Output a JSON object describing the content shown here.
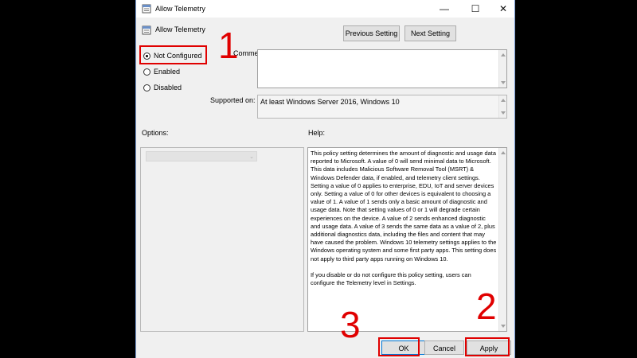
{
  "window": {
    "title": "Allow Telemetry",
    "minimize_glyph": "—",
    "maximize_glyph": "☐",
    "close_glyph": "✕"
  },
  "header": {
    "policy_title": "Allow Telemetry",
    "previous_setting": "Previous Setting",
    "next_setting": "Next Setting"
  },
  "state": {
    "options": [
      {
        "label": "Not Configured",
        "selected": true
      },
      {
        "label": "Enabled",
        "selected": false
      },
      {
        "label": "Disabled",
        "selected": false
      }
    ]
  },
  "comment": {
    "label": "Comment:",
    "value": ""
  },
  "supported": {
    "label": "Supported on:",
    "value": "At least Windows Server 2016, Windows 10"
  },
  "panels": {
    "options_label": "Options:",
    "help_label": "Help:"
  },
  "help": {
    "text": "This policy setting determines the amount of diagnostic and usage data reported to Microsoft. A value of 0 will send minimal data to Microsoft. This data includes Malicious Software Removal Tool (MSRT) & Windows Defender data, if enabled, and telemetry client settings. Setting a value of 0 applies to enterprise, EDU, IoT and server devices only. Setting a value of 0 for other devices is equivalent to choosing a value of 1. A value of 1 sends only a basic amount of diagnostic and usage data. Note that setting values of 0 or 1 will degrade certain experiences on the device. A value of 2 sends enhanced diagnostic and usage data. A value of 3 sends the same data as a value of 2, plus additional diagnostics data, including the files and content that may have caused the problem. Windows 10 telemetry settings applies to the Windows operating system and some first party apps. This setting does not apply to third party apps running on Windows 10.\n\nIf you disable or do not configure this policy setting, users can configure the Telemetry level in Settings."
  },
  "footer": {
    "ok": "OK",
    "cancel": "Cancel",
    "apply": "Apply"
  },
  "annotations": {
    "step1": "1",
    "step2": "2",
    "step3": "3",
    "color": "#e00000"
  }
}
